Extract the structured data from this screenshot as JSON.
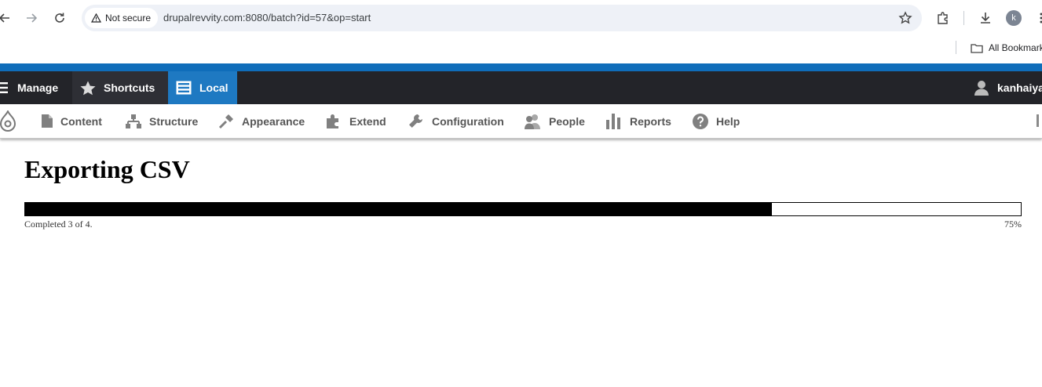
{
  "browser": {
    "security_label": "Not secure",
    "url": "drupalrevvity.com:8080/batch?id=57&op=start",
    "avatar_letter": "k",
    "bookmarks_label": "All Bookmarks",
    "icons": [
      "back-arrow-icon",
      "forward-arrow-icon",
      "reload-icon",
      "warning-icon",
      "bookmark-star-icon",
      "extensions-icon",
      "download-icon",
      "more-menu-icon",
      "folder-icon"
    ]
  },
  "toolbar": {
    "manage_label": "Manage",
    "shortcuts_label": "Shortcuts",
    "local_label": "Local",
    "user_label": "kanhaiya",
    "colors": {
      "top_strip": "#0f6dba",
      "bar": "#232429",
      "local_tab": "#1e79c2"
    }
  },
  "admin_menu": {
    "items": [
      {
        "label": "Content",
        "icon": "file-icon"
      },
      {
        "label": "Structure",
        "icon": "structure-icon"
      },
      {
        "label": "Appearance",
        "icon": "paintbrush-icon"
      },
      {
        "label": "Extend",
        "icon": "puzzle-icon"
      },
      {
        "label": "Configuration",
        "icon": "wrench-icon"
      },
      {
        "label": "People",
        "icon": "people-icon"
      },
      {
        "label": "Reports",
        "icon": "bar-chart-icon"
      },
      {
        "label": "Help",
        "icon": "help-icon"
      }
    ]
  },
  "page": {
    "title": "Exporting CSV",
    "progress_message": "Completed 3 of 4.",
    "progress_percent_label": "75%",
    "progress_value": 0.75
  }
}
